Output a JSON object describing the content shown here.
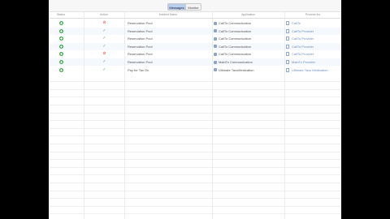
{
  "toolbar": {
    "segments": [
      {
        "label": "Messages",
        "selected": true
      },
      {
        "label": "Monitor",
        "selected": false
      }
    ]
  },
  "table": {
    "headers": [
      "Status",
      "Action",
      "Incident Name",
      "Application",
      "Process Ins"
    ],
    "rows": [
      {
        "status": "active",
        "action": "error",
        "incident": "Reservation Pool",
        "application": "CallTo Communication",
        "process": "CallTo"
      },
      {
        "status": "active",
        "action": "ok",
        "incident": "Reservation Pool",
        "application": "CallTo Communication",
        "process": "CallTo Provider"
      },
      {
        "status": "active",
        "action": "ok",
        "incident": "Reservation Pool",
        "application": "CallTo Communication",
        "process": "CallTo Provider"
      },
      {
        "status": "active",
        "action": "ok",
        "incident": "Reservation Pool",
        "application": "CallTo Communication",
        "process": "CallTo Provider"
      },
      {
        "status": "active",
        "action": "error",
        "incident": "Reservation Pool",
        "application": "CallTo Communication",
        "process": "CallTo Provider"
      },
      {
        "status": "active",
        "action": "ok",
        "incident": "Reservation Pool",
        "application": "MainTo Communication",
        "process": "MainTo Provider"
      },
      {
        "status": "active",
        "action": "ok",
        "incident": "Pay for Tax On",
        "application": "Ultimate TaxoMedication",
        "process": "Ultimate Taxo Medication"
      }
    ]
  },
  "colors": {
    "selected_segment": "#b9cff0",
    "status_green": "#3bb34a",
    "action_error": "#e0433b",
    "action_ok": "#4caf50"
  },
  "icons": {
    "status": "plus-circle-icon",
    "action_ok": "check-icon",
    "action_error": "error-circle-icon",
    "application": "app-icon",
    "process": "document-icon"
  }
}
